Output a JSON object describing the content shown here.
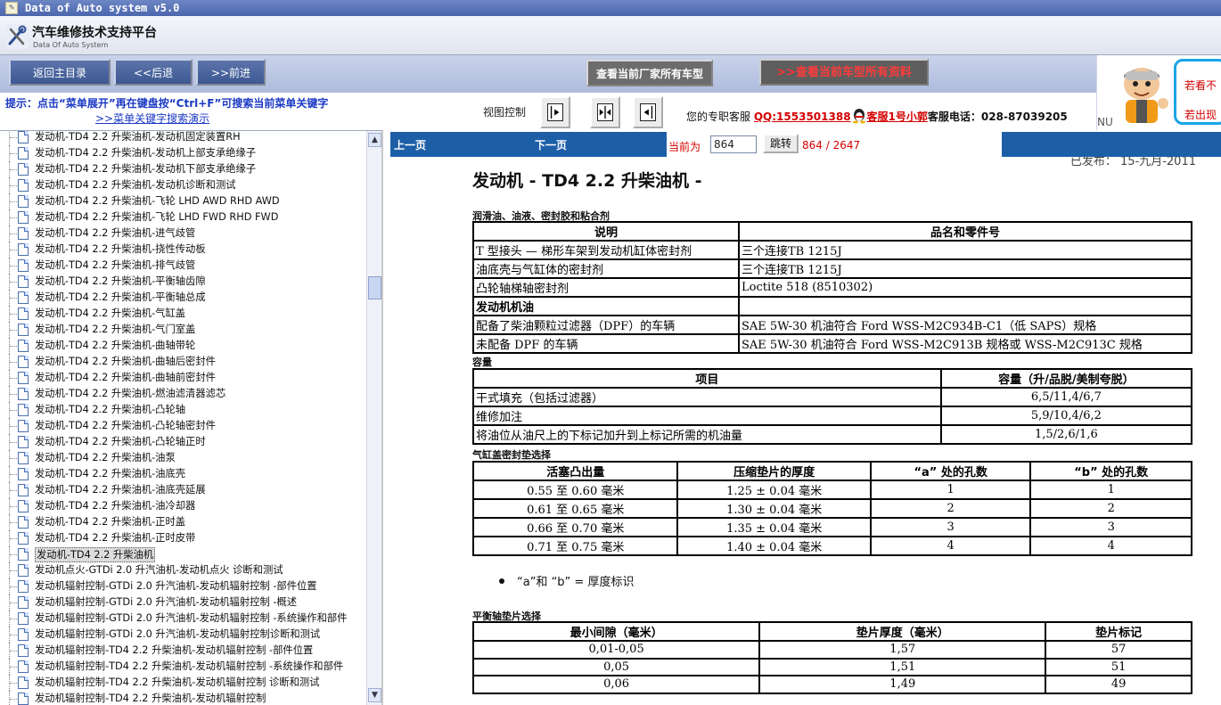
{
  "window": {
    "title": "Data of Auto system v5.0"
  },
  "brand": {
    "title": "汽车维修技术支持平台",
    "subtitle": "Data Of Auto System"
  },
  "toolbar": {
    "home": "返回主目录",
    "back": "<<后退",
    "forward": ">>前进",
    "view_makers": "查看当前厂家所有车型",
    "view_all_prefix": ">>",
    "view_all": "查看当前车型所有资料"
  },
  "hint": {
    "text": "提示：点击“菜单展开”再在键盘按“Ctrl+F”可搜索当前菜单关键字",
    "link": ">>菜单关键字搜索演示"
  },
  "view_control": {
    "label": "视图控制"
  },
  "service": {
    "prefix": "您的专职客服",
    "qq": "QQ:1553501388",
    "kf": "客服1号小郭",
    "phone_label": "客服电话：",
    "phone": "028-87039205"
  },
  "ad": {
    "nu": "NU",
    "line1": "若看不",
    "line2": "若出现"
  },
  "tree": {
    "items": [
      "发动机-TD4 2.2 升柴油机-发动机固定装置RH",
      "发动机-TD4 2.2 升柴油机-发动机上部支承绝缘子",
      "发动机-TD4 2.2 升柴油机-发动机下部支承绝缘子",
      "发动机-TD4 2.2 升柴油机-发动机诊断和测试",
      "发动机-TD4 2.2 升柴油机-飞轮  LHD AWD RHD AWD",
      "发动机-TD4 2.2 升柴油机-飞轮  LHD FWD RHD FWD",
      "发动机-TD4 2.2 升柴油机-进气歧管",
      "发动机-TD4 2.2 升柴油机-挠性传动板",
      "发动机-TD4 2.2 升柴油机-排气歧管",
      "发动机-TD4 2.2 升柴油机-平衡轴齿隙",
      "发动机-TD4 2.2 升柴油机-平衡轴总成",
      "发动机-TD4 2.2 升柴油机-气缸盖",
      "发动机-TD4 2.2 升柴油机-气门室盖",
      "发动机-TD4 2.2 升柴油机-曲轴带轮",
      "发动机-TD4 2.2 升柴油机-曲轴后密封件",
      "发动机-TD4 2.2 升柴油机-曲轴前密封件",
      "发动机-TD4 2.2 升柴油机-燃油滤清器滤芯",
      "发动机-TD4 2.2 升柴油机-凸轮轴",
      "发动机-TD4 2.2 升柴油机-凸轮轴密封件",
      "发动机-TD4 2.2 升柴油机-凸轮轴正时",
      "发动机-TD4 2.2 升柴油机-油泵",
      "发动机-TD4 2.2 升柴油机-油底壳",
      "发动机-TD4 2.2 升柴油机-油底壳延展",
      "发动机-TD4 2.2 升柴油机-油冷却器",
      "发动机-TD4 2.2 升柴油机-正时盖",
      "发动机-TD4 2.2 升柴油机-正时皮带",
      "发动机-TD4 2.2 升柴油机",
      "发动机点火-GTDi 2.0 升汽油机-发动机点火 诊断和测试",
      "发动机辐射控制-GTDi 2.0 升汽油机-发动机辐射控制  -部件位置",
      "发动机辐射控制-GTDi 2.0 升汽油机-发动机辐射控制  -概述",
      "发动机辐射控制-GTDi 2.0 升汽油机-发动机辐射控制  -系统操作和部件",
      "发动机辐射控制-GTDi 2.0 升汽油机-发动机辐射控制诊断和测试",
      "发动机辐射控制-TD4 2.2 升柴油机-发动机辐射控制  -部件位置",
      "发动机辐射控制-TD4 2.2 升柴油机-发动机辐射控制  -系统操作和部件",
      "发动机辐射控制-TD4 2.2 升柴油机-发动机辐射控制 诊断和测试",
      "发动机辐射控制-TD4 2.2 升柴油机-发动机辐射控制"
    ],
    "selected_index": 26
  },
  "nav": {
    "prev": "上一页",
    "next": "下一页",
    "current_label": "当前为",
    "current_value": "864",
    "jump": "跳转",
    "page_info": "864 / 2647"
  },
  "doc": {
    "pubdate": "已发布：  15-九月-2011",
    "title": "发动机 - TD4 2.2 升柴油机 -",
    "sec1": "润滑油、油液、密封胶和粘合剂",
    "t1_head": [
      "说明",
      "品名和零件号"
    ],
    "t1_rows": [
      [
        "T 型接头 — 梯形车架到发动机缸体密封剂",
        "三个连接TB 1215J"
      ],
      [
        "油底壳与气缸体的密封剂",
        "三个连接TB 1215J"
      ],
      [
        "凸轮轴梯轴密封剂",
        "Loctite 518 (8510302)"
      ],
      [
        "发动机机油",
        ""
      ],
      [
        "配备了柴油颗粒过滤器（DPF）的车辆",
        "SAE 5W-30 机油符合 Ford WSS-M2C934B-C1（低 SAPS）规格"
      ],
      [
        "未配备 DPF 的车辆",
        "SAE 5W-30 机油符合 Ford WSS-M2C913B 规格或 WSS-M2C913C 规格"
      ]
    ],
    "sec2": "容量",
    "t2_head": [
      "项目",
      "容量（升/品脱/美制夸脱）"
    ],
    "t2_rows": [
      [
        "干式填充（包括过滤器）",
        "6,5/11,4/6,7"
      ],
      [
        "维修加注",
        "5,9/10,4/6,2"
      ],
      [
        "将油位从油尺上的下标记加升到上标记所需的机油量",
        "1,5/2,6/1,6"
      ]
    ],
    "sec3": "气缸盖密封垫选择",
    "t3_head": [
      "活塞凸出量",
      "压缩垫片的厚度",
      "“a” 处的孔数",
      "“b” 处的孔数"
    ],
    "t3_rows": [
      [
        "0.55 至 0.60 毫米",
        "1.25 ± 0.04 毫米",
        "1",
        "1"
      ],
      [
        "0.61 至 0.65 毫米",
        "1.30 ± 0.04 毫米",
        "2",
        "2"
      ],
      [
        "0.66 至 0.70 毫米",
        "1.35 ± 0.04 毫米",
        "3",
        "3"
      ],
      [
        "0.71 至 0.75 毫米",
        "1.40 ± 0.04 毫米",
        "4",
        "4"
      ]
    ],
    "bullet": "“a”和 “b” = 厚度标识",
    "sec4": "平衡轴垫片选择",
    "t4_head": [
      "最小间隙（毫米）",
      "垫片厚度（毫米）",
      "垫片标记"
    ],
    "t4_rows": [
      [
        "0,01-0,05",
        "1,57",
        "57"
      ],
      [
        "0,05",
        "1,51",
        "51"
      ],
      [
        "0,06",
        "1,49",
        "49"
      ]
    ]
  }
}
